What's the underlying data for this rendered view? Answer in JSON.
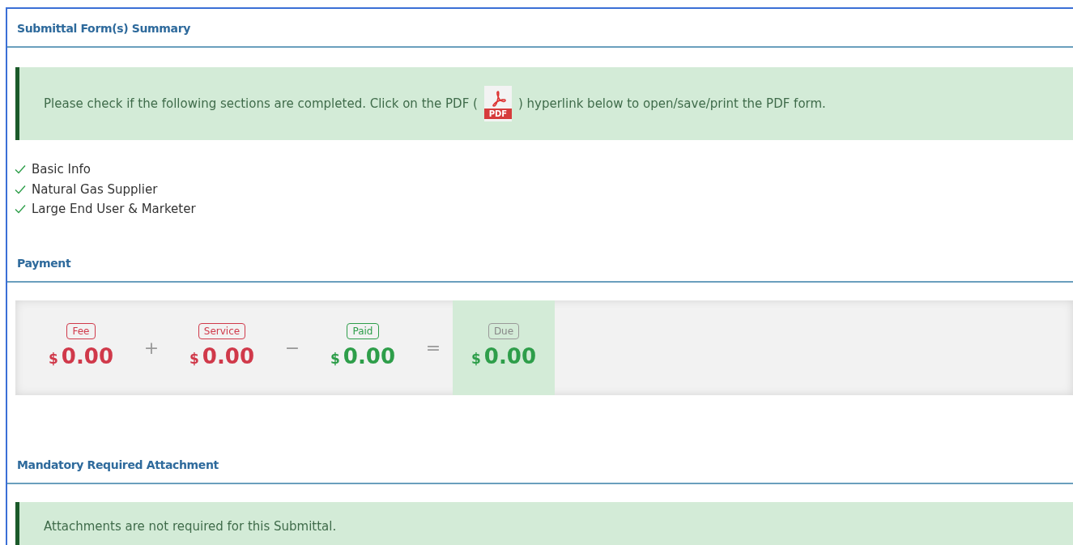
{
  "sections": [
    {
      "kind": "checklist",
      "title": "Submittal Form(s) Summary",
      "alert": {
        "before": "Please check if the following sections are completed. Click on the PDF (",
        "icon_label": "PDF",
        "after": ") hyperlink below to open/save/print the PDF form."
      },
      "items": [
        {
          "label": "Basic Info",
          "checked": true
        },
        {
          "label": "Natural Gas Supplier",
          "checked": true
        },
        {
          "label": "Large End User & Marketer",
          "checked": true
        }
      ]
    },
    {
      "kind": "payment",
      "title": "Payment",
      "amounts": [
        {
          "label": "Fee",
          "currency": "$",
          "amount": "0.00",
          "color": "#d0394a",
          "highlighted": false
        },
        {
          "label": "Service",
          "currency": "$",
          "amount": "0.00",
          "color": "#d0394a",
          "highlighted": false
        },
        {
          "label": "Paid",
          "currency": "$",
          "amount": "0.00",
          "color": "#2e9e4a",
          "highlighted": false
        },
        {
          "label": "Due",
          "currency": "$",
          "amount": "0.00",
          "color": "#2e9e4a",
          "highlighted": true
        }
      ],
      "operators": [
        "+",
        "−",
        "="
      ]
    },
    {
      "kind": "notice",
      "title": "Mandatory Required Attachment",
      "alert": {
        "before": "Attachments are not required for this Submittal."
      }
    }
  ]
}
